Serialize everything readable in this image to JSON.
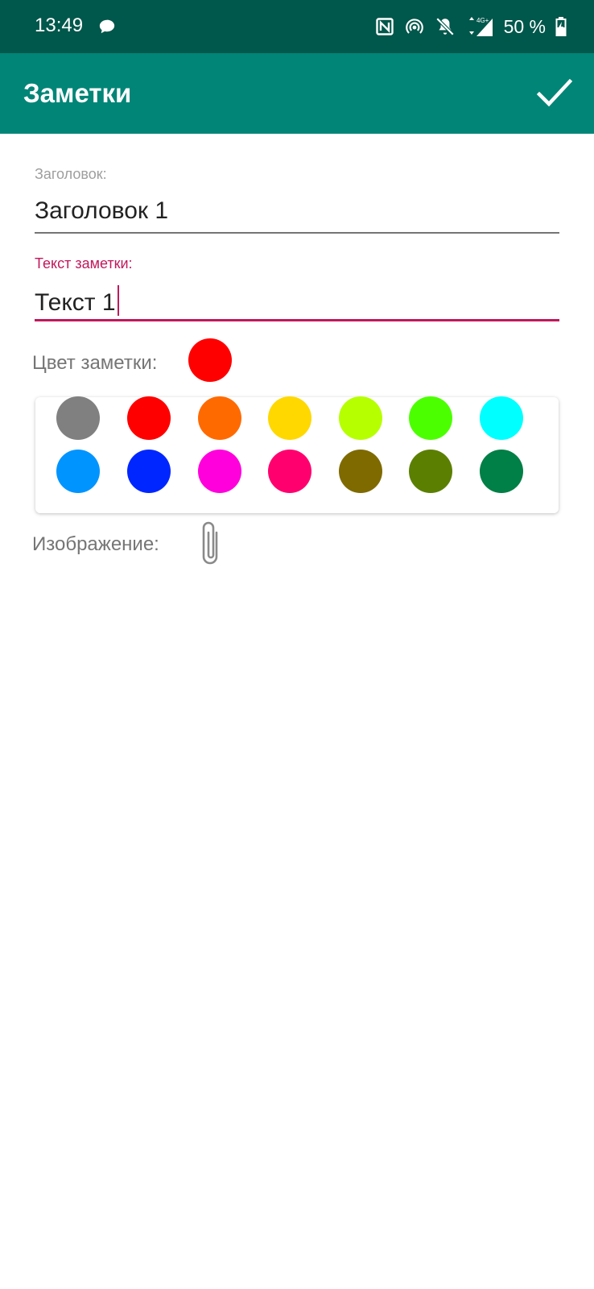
{
  "status_bar": {
    "time": "13:49",
    "battery": "50 %",
    "network": "4G+",
    "icons": [
      "message-icon",
      "nfc-icon",
      "hotspot-icon",
      "notifications-off-icon",
      "signal-icon",
      "battery-icon"
    ]
  },
  "app_bar": {
    "title": "Заметки",
    "save_icon": "checkmark-icon"
  },
  "form": {
    "title_label": "Заголовок:",
    "title_value": "Заголовок 1",
    "text_label": "Текст заметки:",
    "text_value": "Текст 1",
    "color_label": "Цвет заметки:",
    "selected_color": "#FF0000",
    "image_label": "Изображение:",
    "attach_icon": "paperclip-icon"
  },
  "palette": {
    "colors": [
      [
        "#808080",
        "#FF0000",
        "#FF6A00",
        "#FFD800",
        "#B6FF00",
        "#4CFF00",
        "#00FFFF"
      ],
      [
        "#0094FF",
        "#0026FF",
        "#FF00DC",
        "#FF006E",
        "#7F6A00",
        "#5B7F00",
        "#007F46"
      ]
    ]
  },
  "theme": {
    "status_bar": "#00574B",
    "primary": "#008577",
    "accent": "#C2185B"
  }
}
